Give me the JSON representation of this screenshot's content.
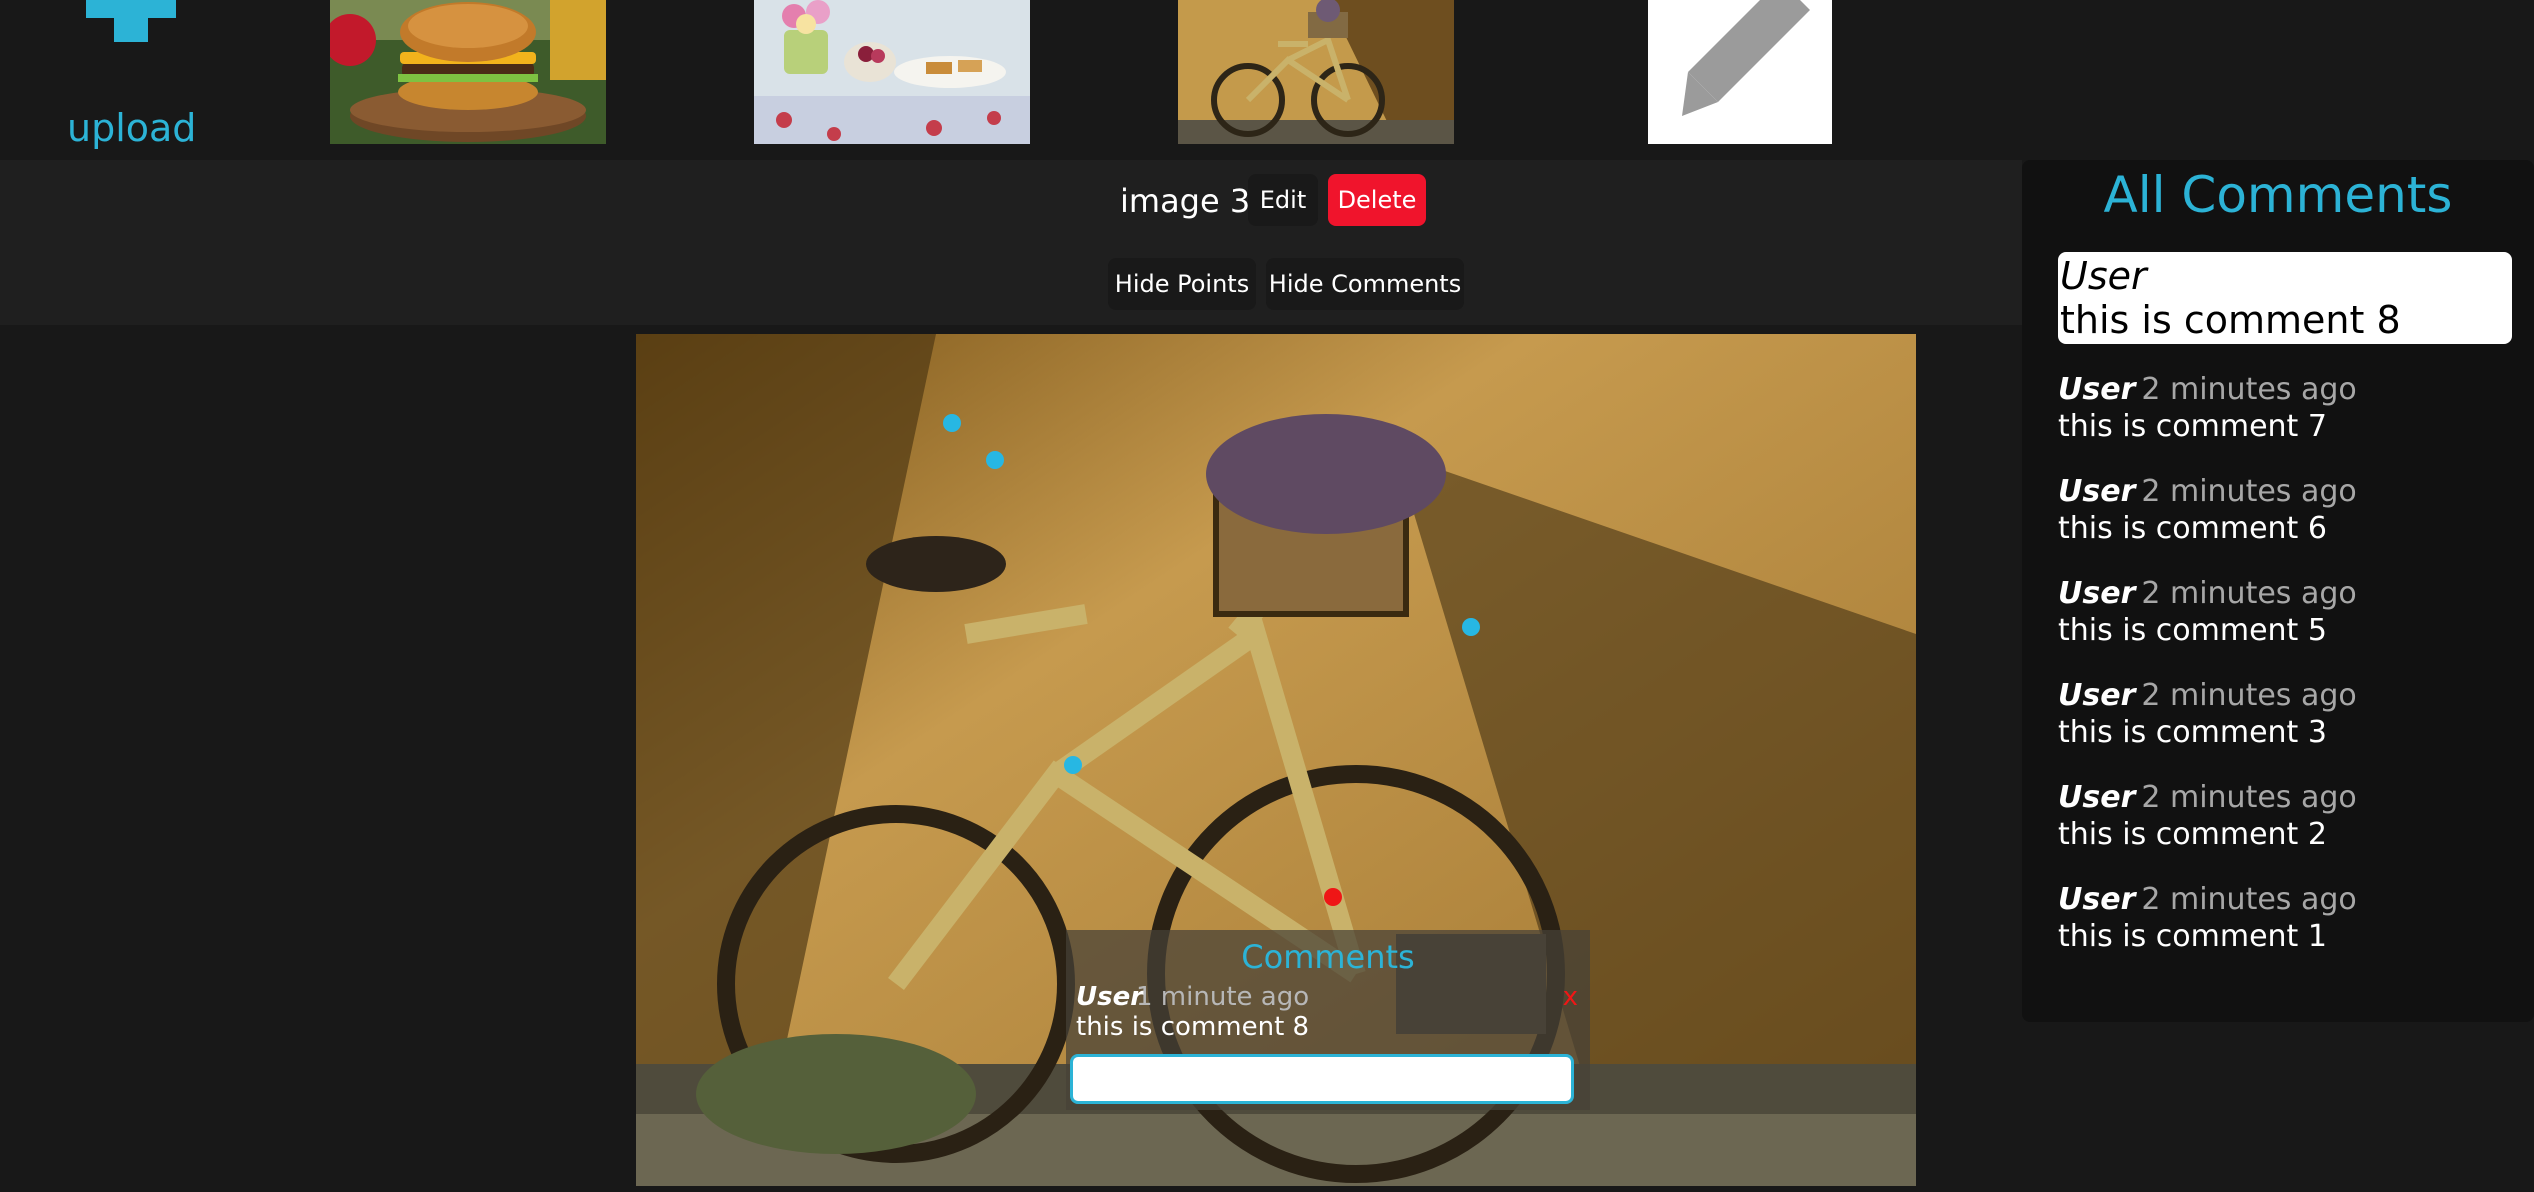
{
  "topbar": {
    "upload_label": "upload",
    "thumbnails": [
      {
        "name": "burger-thumbnail"
      },
      {
        "name": "breakfast-table-thumbnail"
      },
      {
        "name": "bicycle-thumbnail"
      },
      {
        "name": "pencil-edit-thumbnail"
      }
    ]
  },
  "toolbar": {
    "image_title": "image 3",
    "edit_label": "Edit",
    "delete_label": "Delete",
    "hide_points_label": "Hide Points",
    "hide_comments_label": "Hide Comments"
  },
  "comment_panel": {
    "title": "Comments",
    "user": "User",
    "time": "1 minute ago",
    "text": "this is comment 8",
    "close_label": "x",
    "input_value": ""
  },
  "sidebar": {
    "title": "All Comments",
    "highlight": {
      "user": "User",
      "text": "this is comment 8"
    },
    "items": [
      {
        "user": "User",
        "time": "2 minutes ago",
        "text": "this is comment 7"
      },
      {
        "user": "User",
        "time": "2 minutes ago",
        "text": "this is comment 6"
      },
      {
        "user": "User",
        "time": "2 minutes ago",
        "text": "this is comment 5"
      },
      {
        "user": "User",
        "time": "2 minutes ago",
        "text": "this is comment 3"
      },
      {
        "user": "User",
        "time": "2 minutes ago",
        "text": "this is comment 2"
      },
      {
        "user": "User",
        "time": "2 minutes ago",
        "text": "this is comment 1"
      }
    ]
  },
  "colors": {
    "accent": "#2cb3d6",
    "delete": "#f0142c",
    "point": "#27b7e3",
    "active_point": "#ef1616",
    "background": "#181818"
  }
}
